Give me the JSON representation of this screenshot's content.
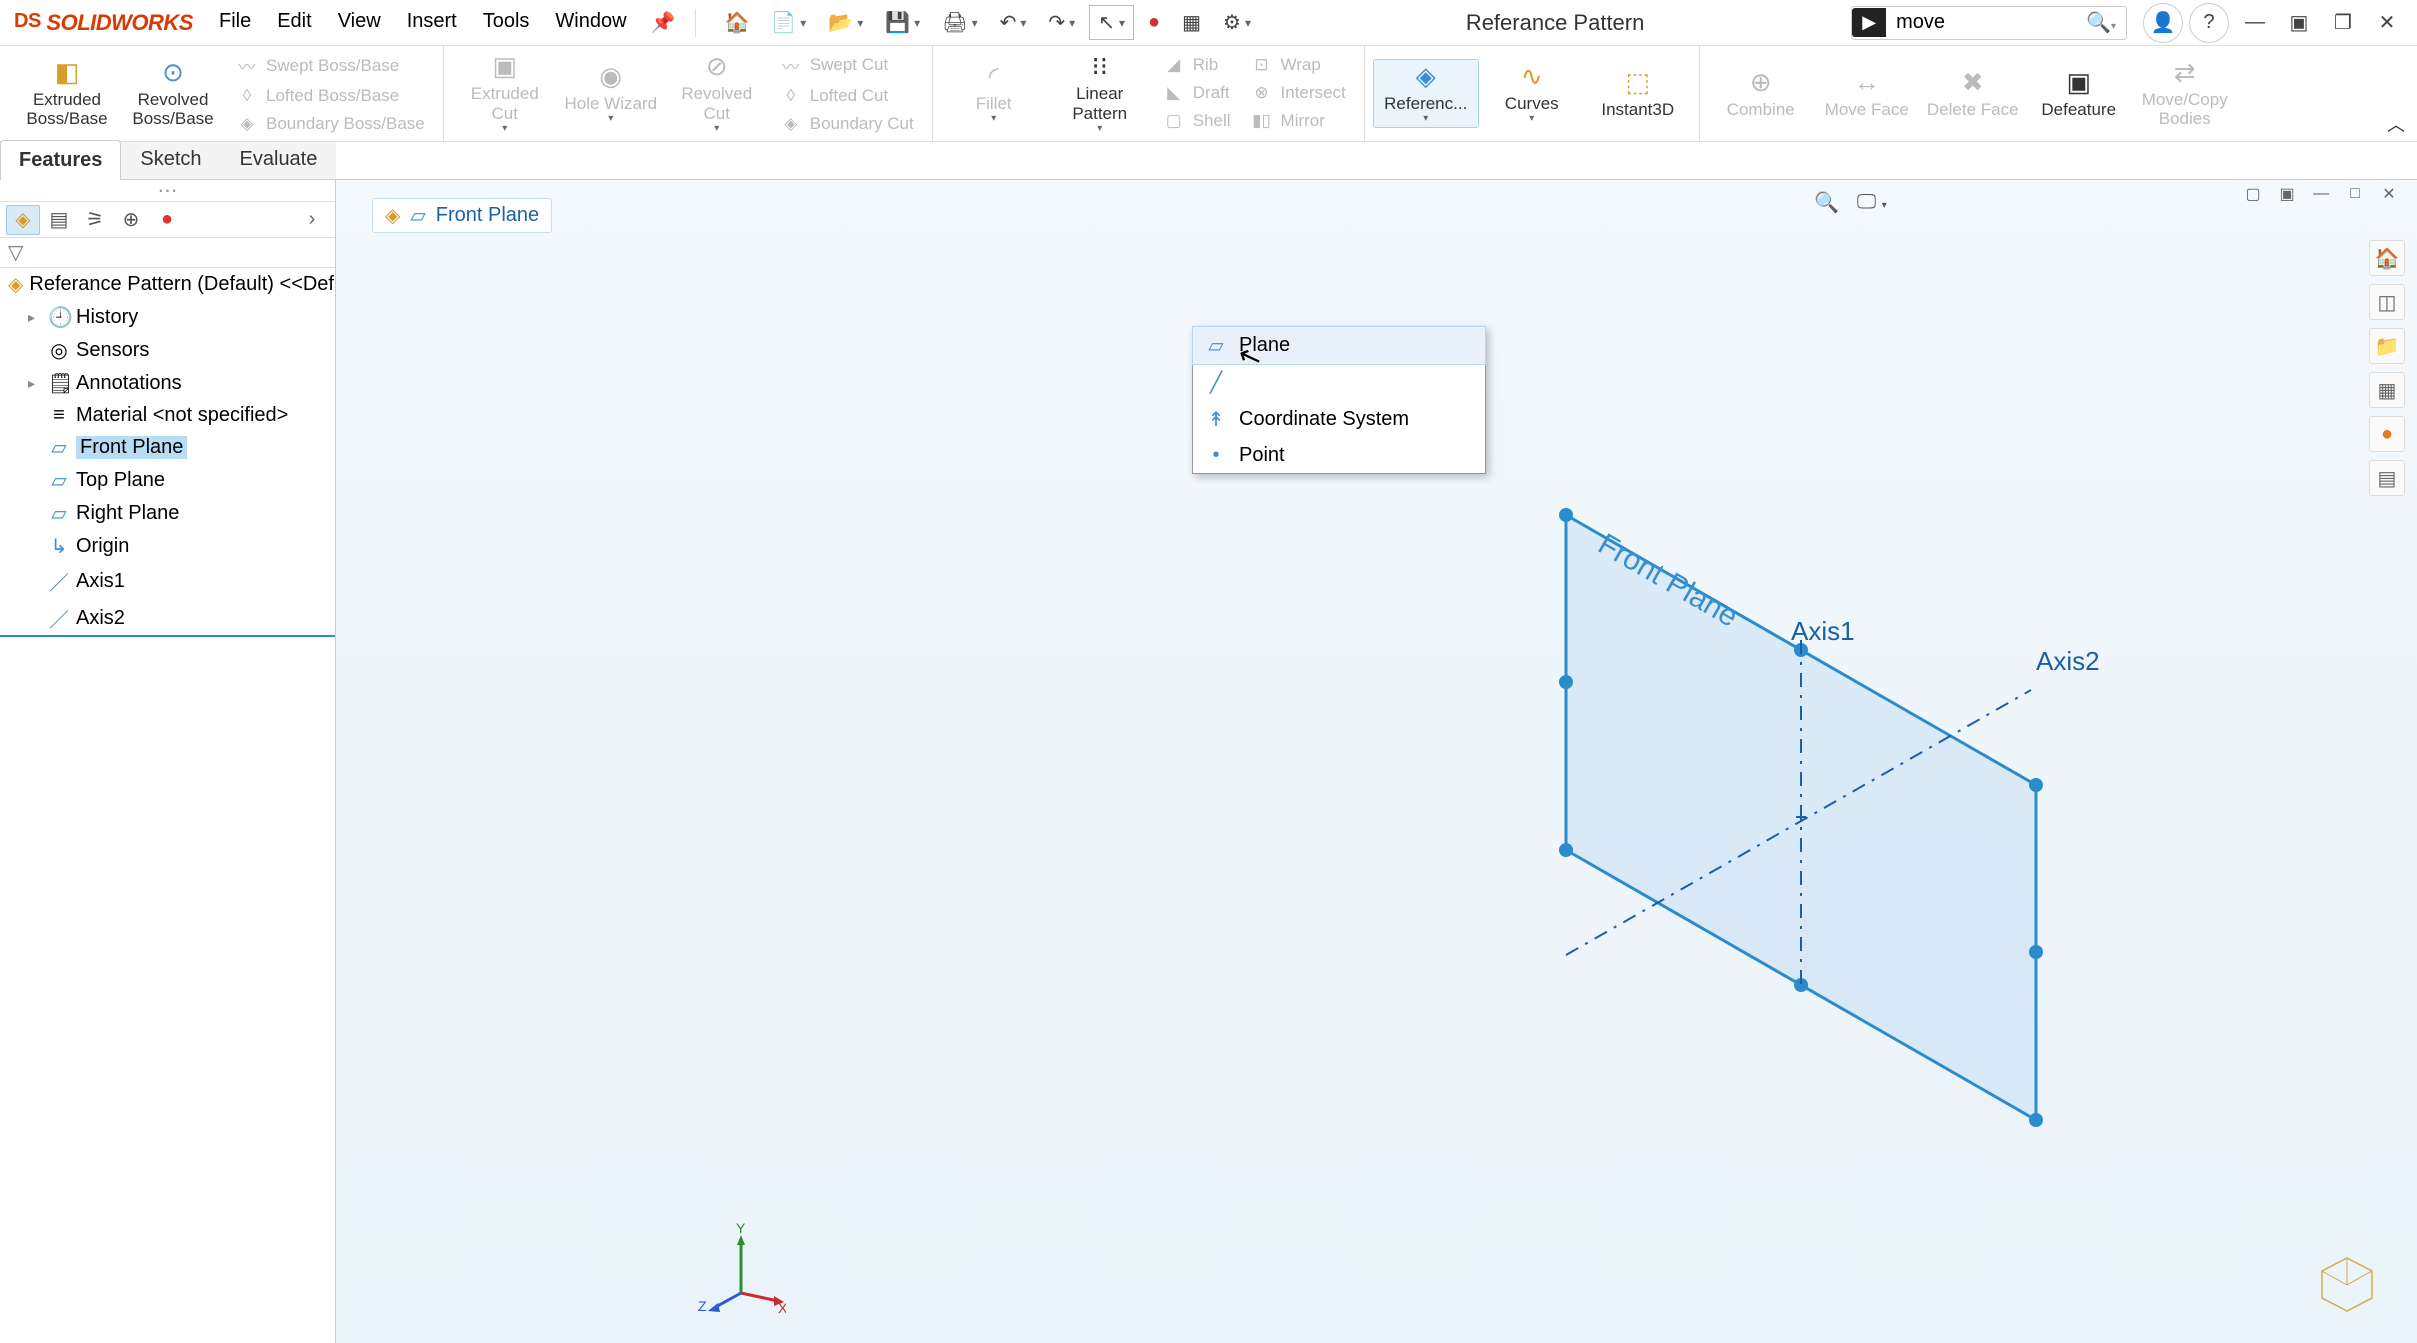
{
  "app": {
    "logo_prefix": "DS",
    "logo_name": "SOLIDWORKS",
    "document_title": "Referance Pattern",
    "search_text": "move",
    "search_placeholder": "Search"
  },
  "menu": {
    "items": [
      "File",
      "Edit",
      "View",
      "Insert",
      "Tools",
      "Window"
    ]
  },
  "qat": {
    "home": "⌂",
    "new": "🗋",
    "open": "📂",
    "save": "💾",
    "print": "🖶",
    "undo": "↶",
    "redo": "↷",
    "select": "▭",
    "rebuild": "●",
    "display": "▦",
    "options": "⚙"
  },
  "ribbon": {
    "extruded_boss": "Extruded Boss/Base",
    "revolved_boss": "Revolved Boss/Base",
    "swept_boss": "Swept Boss/Base",
    "lofted_boss": "Lofted Boss/Base",
    "boundary_boss": "Boundary Boss/Base",
    "extruded_cut": "Extruded Cut",
    "hole_wizard": "Hole Wizard",
    "revolved_cut": "Revolved Cut",
    "swept_cut": "Swept Cut",
    "lofted_cut": "Lofted Cut",
    "boundary_cut": "Boundary Cut",
    "fillet": "Fillet",
    "linear_pattern": "Linear Pattern",
    "rib": "Rib",
    "draft": "Draft",
    "shell": "Shell",
    "wrap": "Wrap",
    "intersect": "Intersect",
    "mirror": "Mirror",
    "reference": "Referenc...",
    "curves": "Curves",
    "instant3d": "Instant3D",
    "combine": "Combine",
    "move_face": "Move Face",
    "delete_face": "Delete Face",
    "defeature": "Defeature",
    "movecopy": "Move/Copy Bodies"
  },
  "tabs": {
    "features": "Features",
    "sketch": "Sketch",
    "evaluate": "Evaluate"
  },
  "tree": {
    "root": "Referance Pattern (Default) <<Defau",
    "history": "History",
    "sensors": "Sensors",
    "annotations": "Annotations",
    "material": "Material <not specified>",
    "front_plane": "Front Plane",
    "top_plane": "Top Plane",
    "right_plane": "Right Plane",
    "origin": "Origin",
    "axis1": "Axis1",
    "axis2": "Axis2"
  },
  "breadcrumb": {
    "label": "Front Plane"
  },
  "dropdown": {
    "plane": "Plane",
    "coord_sys": "Coordinate System",
    "point": "Point"
  },
  "scene": {
    "plane_label": "Front Plane",
    "axis1_label": "Axis1",
    "axis2_label": "Axis2",
    "triad_x": "X",
    "triad_y": "Y",
    "triad_z": "Z"
  }
}
